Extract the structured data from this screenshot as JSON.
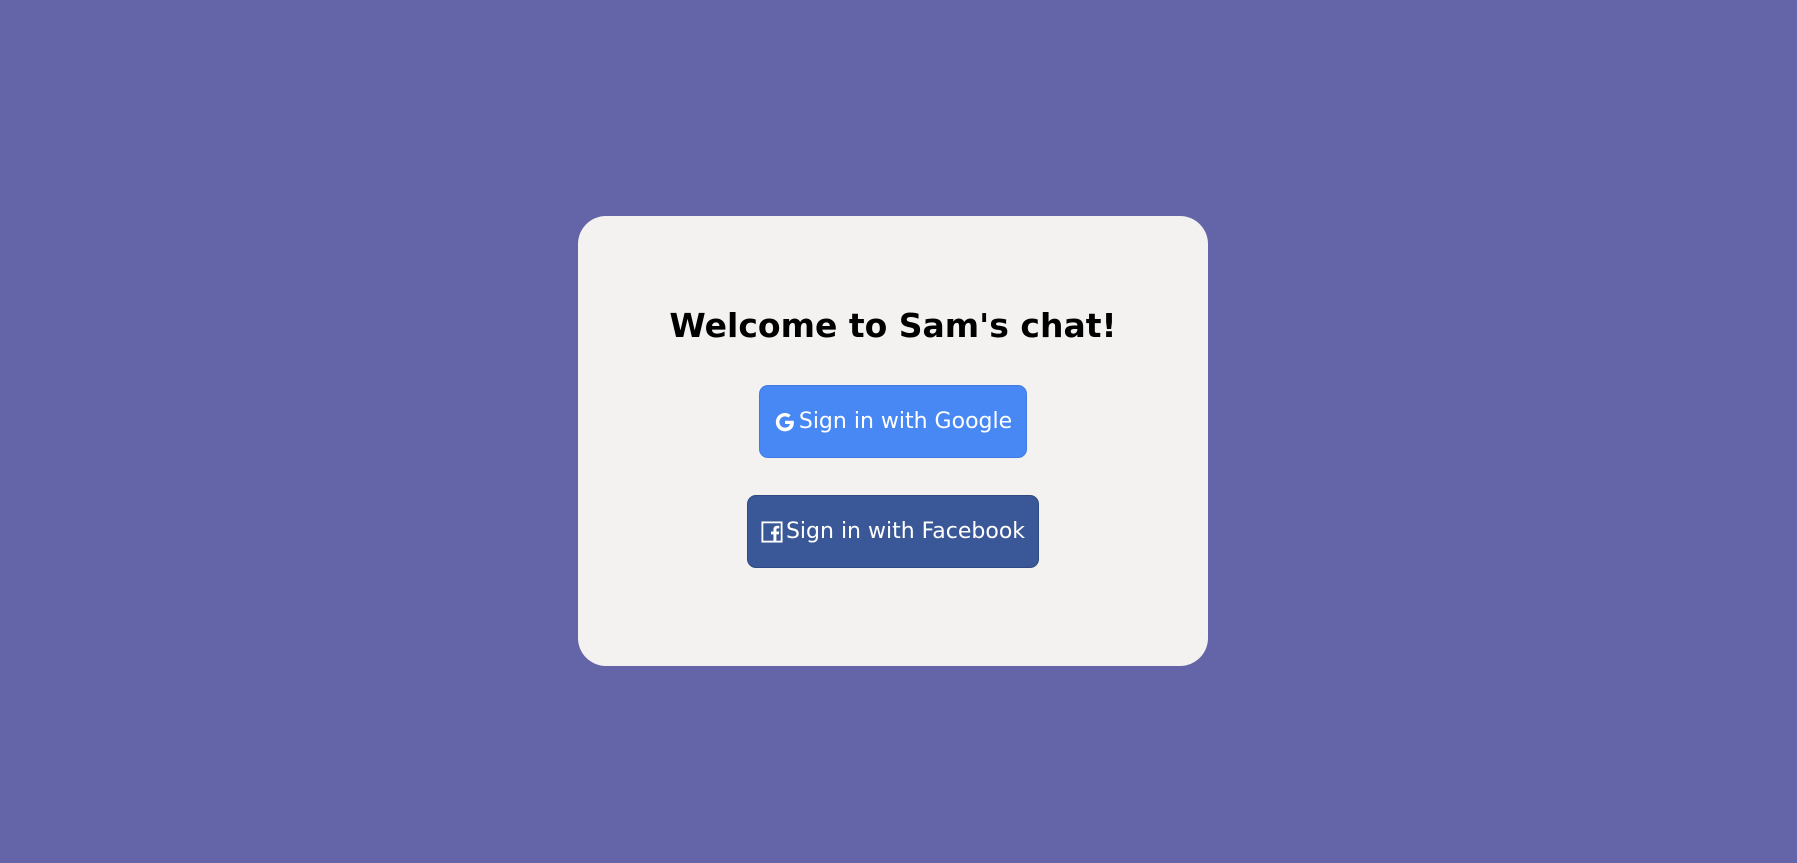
{
  "page": {
    "background_color": "#6464a8"
  },
  "login_card": {
    "background_color": "#f3f2f0",
    "title": "Welcome to Sam's chat!",
    "google_button": {
      "label": "Sign in with Google",
      "icon": "google-icon",
      "color": "#4788f4"
    },
    "facebook_button": {
      "label": "Sign in with Facebook",
      "icon": "facebook-icon",
      "color": "#3a5897"
    }
  }
}
